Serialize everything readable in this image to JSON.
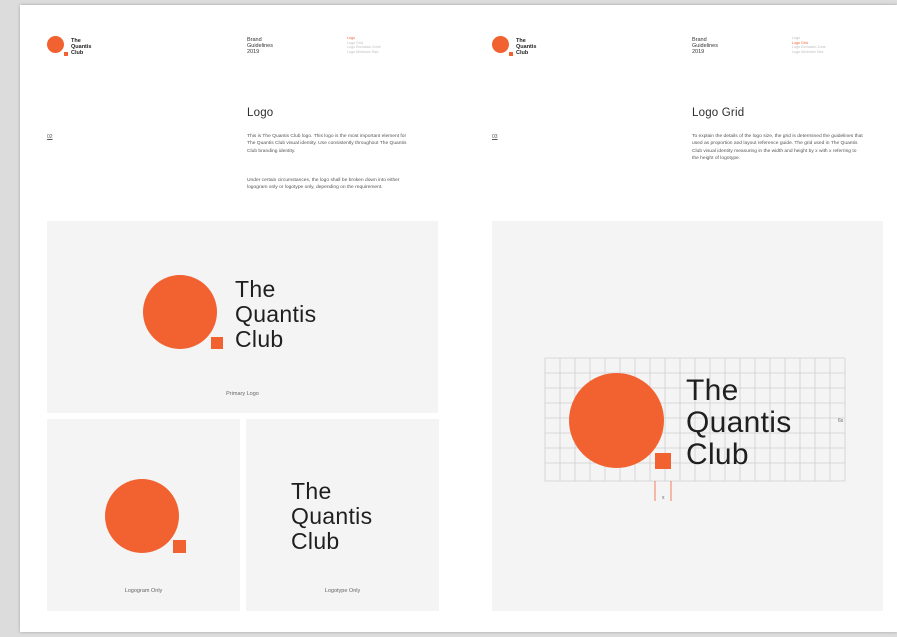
{
  "brand": {
    "name_lines": [
      "The",
      "Quantis",
      "Club"
    ],
    "orange": "#f26130"
  },
  "header": {
    "doc_lines": [
      "Brand",
      "Guidelines",
      "2019"
    ],
    "nav_left": [
      "Logo",
      "Logo Grid",
      "Logo Exclusion Zone",
      "Logo Minimum Size"
    ],
    "nav_right": [
      "Logo",
      "Logo Grid",
      "Logo Exclusion Zone",
      "Logo Minimum Size"
    ]
  },
  "left_page": {
    "page_number": "02",
    "title": "Logo",
    "paragraph1": "This is The Quantis Club logo. This logo is the most important element for The Quantis Club visual identity. Use consistently throughout The Quantis Club branding identity.",
    "paragraph2": "Under certain circumstances, the logo shall be broken down into either logogram only or logotype only, depending on the requirement.",
    "captions": {
      "primary": "Primary Logo",
      "logogram": "Logogram Only",
      "logotype": "Logotype Only"
    }
  },
  "right_page": {
    "page_number": "03",
    "title": "Logo Grid",
    "paragraph": "To explain the details of the logo size, the grid is determined the guidelines that used as proportion and layout reference guide. The grid used in The Quantis Club visual identity measuring in the width and height by x with x referring to the height of logotype.",
    "label_6x": "6x",
    "label_x": "x"
  }
}
